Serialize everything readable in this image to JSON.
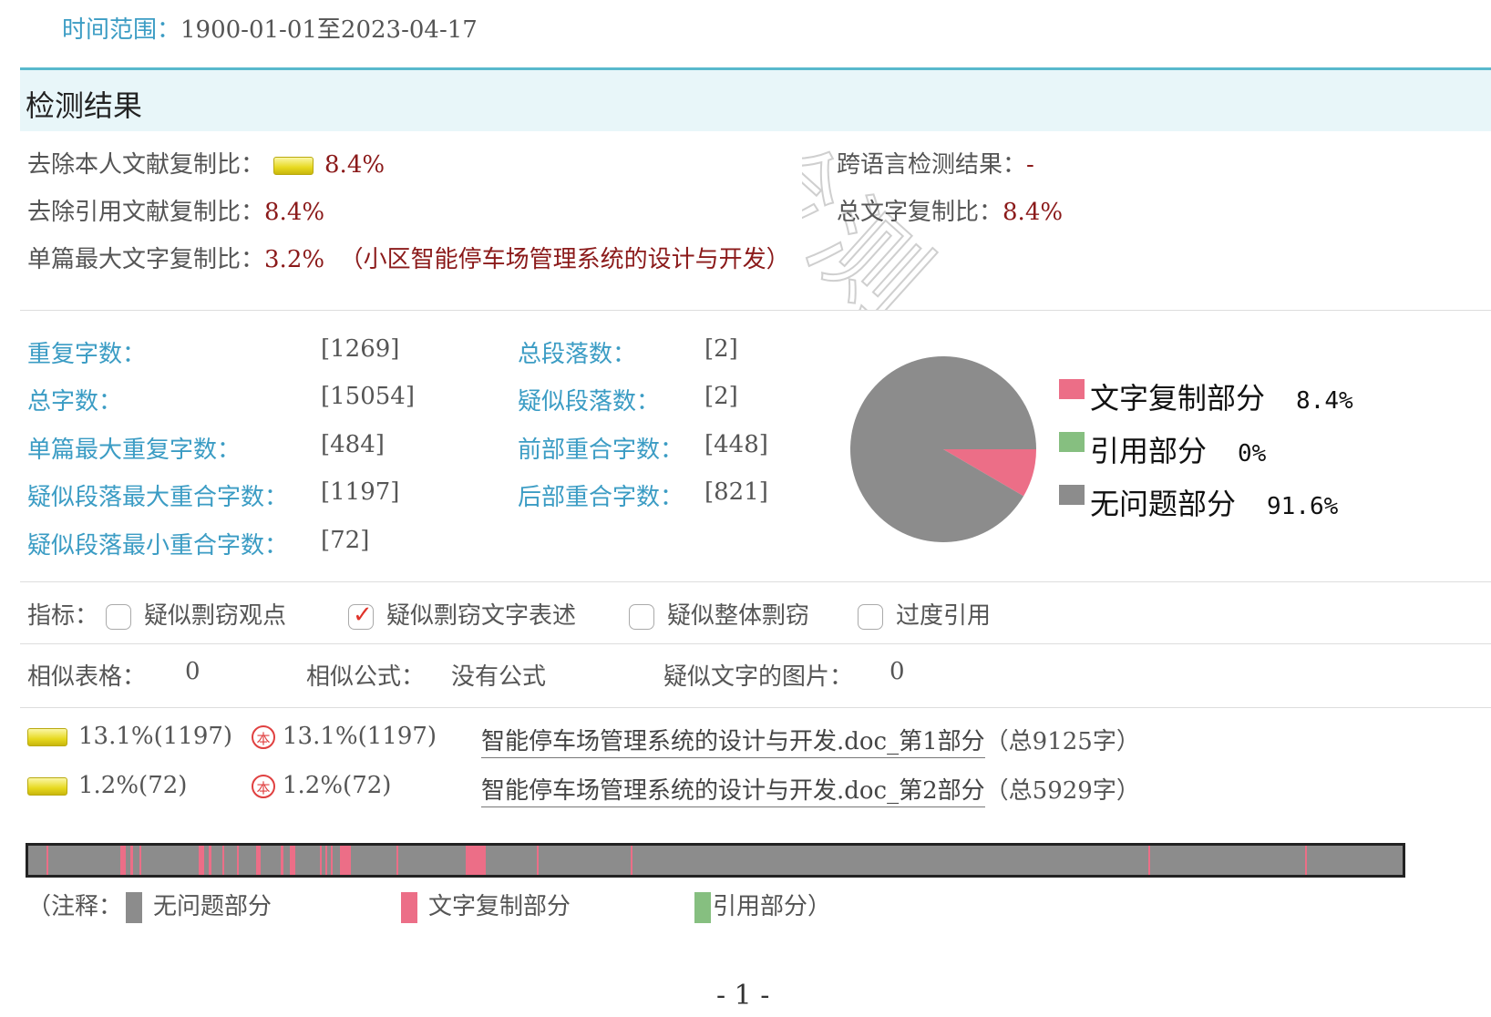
{
  "time_range": {
    "label": "时间范围：",
    "value": "1900-01-01至2023-04-17"
  },
  "results_title": "检测结果",
  "summary": {
    "self_removed_label": "去除本人文献复制比：",
    "self_removed_value": "8.4%",
    "cross_lang_label": "跨语言检测结果：",
    "cross_lang_value": "-",
    "ref_removed_label": "去除引用文献复制比：",
    "ref_removed_value": "8.4%",
    "total_copy_label": "总文字复制比：",
    "total_copy_value": "8.4%",
    "single_max_label": "单篇最大文字复制比：",
    "single_max_value": "3.2%",
    "single_max_source": "（小区智能停车场管理系统的设计与开发）"
  },
  "stats": {
    "dup_chars_label": "重复字数：",
    "dup_chars": "[1269]",
    "total_paras_label": "总段落数：",
    "total_paras": "[2]",
    "total_chars_label": "总字数：",
    "total_chars": "[15054]",
    "susp_paras_label": "疑似段落数：",
    "susp_paras": "[2]",
    "single_max_dup_label": "单篇最大重复字数：",
    "single_max_dup": "[484]",
    "front_overlap_label": "前部重合字数：",
    "front_overlap": "[448]",
    "para_max_overlap_label": "疑似段落最大重合字数：",
    "para_max_overlap": "[1197]",
    "back_overlap_label": "后部重合字数：",
    "back_overlap": "[821]",
    "para_min_overlap_label": "疑似段落最小重合字数：",
    "para_min_overlap": "[72]"
  },
  "pie": {
    "legend": [
      {
        "label": "文字复制部分",
        "pct": "8.4%",
        "color": "#ec6e87"
      },
      {
        "label": "引用部分",
        "pct": "0%",
        "color": "#86bf80"
      },
      {
        "label": "无问题部分",
        "pct": "91.6%",
        "color": "#8c8c8c"
      }
    ],
    "values": [
      8.4,
      0,
      91.6
    ]
  },
  "indicators": {
    "label": "指标：",
    "items": [
      {
        "label": "疑似剽窃观点",
        "checked": false
      },
      {
        "label": "疑似剽窃文字表述",
        "checked": true
      },
      {
        "label": "疑似整体剽窃",
        "checked": false
      },
      {
        "label": "过度引用",
        "checked": false
      }
    ]
  },
  "similar": {
    "tables_label": "相似表格：",
    "tables_value": "0",
    "formulas_label": "相似公式：",
    "formulas_value": "没有公式",
    "images_label": "疑似文字的图片：",
    "images_value": "0"
  },
  "documents": [
    {
      "ratio": "13.1%(1197)",
      "ratio2": "13.1%(1197)",
      "title": "智能停车场管理系统的设计与开发.doc_第1部分",
      "total": "（总9125字）"
    },
    {
      "ratio": "1.2%(72)",
      "ratio2": "1.2%(72)",
      "title": "智能停车场管理系统的设计与开发.doc_第2部分",
      "total": "（总5929字）"
    }
  ],
  "stamp_char": "本",
  "segment_bar": {
    "copy_color": "#ec6e87",
    "segments": [
      [
        0.013,
        0.0015
      ],
      [
        0.067,
        0.004
      ],
      [
        0.074,
        0.002
      ],
      [
        0.081,
        0.0015
      ],
      [
        0.124,
        0.004
      ],
      [
        0.131,
        0.002
      ],
      [
        0.141,
        0.0015
      ],
      [
        0.152,
        0.0015
      ],
      [
        0.166,
        0.003
      ],
      [
        0.184,
        0.0015
      ],
      [
        0.19,
        0.0045
      ],
      [
        0.212,
        0.0015
      ],
      [
        0.216,
        0.0015
      ],
      [
        0.22,
        0.0015
      ],
      [
        0.227,
        0.004
      ],
      [
        0.231,
        0.004
      ],
      [
        0.268,
        0.0015
      ],
      [
        0.318,
        0.015
      ],
      [
        0.37,
        0.0015
      ],
      [
        0.438,
        0.0015
      ],
      [
        0.815,
        0.0015
      ],
      [
        0.929,
        0.0015
      ]
    ]
  },
  "legend_note": {
    "prefix": "（注释：",
    "none_label": "无问题部分",
    "copy_label": "文字复制部分",
    "ref_label": "引用部分）",
    "colors": {
      "none": "#8c8c8c",
      "copy": "#ec6e87",
      "ref": "#86bf80"
    }
  },
  "page_number": "- 1 -",
  "watermark_text": "检测"
}
